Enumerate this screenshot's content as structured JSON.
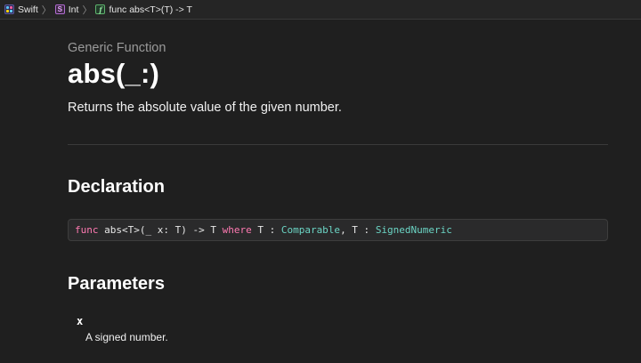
{
  "breadcrumb": [
    {
      "label": "Swift",
      "icon": "swift-module-icon"
    },
    {
      "label": "Int",
      "icon": "struct-icon",
      "badge": "S"
    },
    {
      "label": "func abs<T>(T) -> T",
      "icon": "function-icon",
      "badge": "f"
    }
  ],
  "header": {
    "eyebrow": "Generic Function",
    "title": "abs(_:)",
    "abstract": "Returns the absolute value of the given number."
  },
  "declaration": {
    "heading": "Declaration",
    "tokens": {
      "kw_func": "func",
      "sig": " abs<T>(_ x: T) -> T ",
      "kw_where": "where",
      "t1": " T : ",
      "type1": "Comparable",
      "t2": ", T : ",
      "type2": "SignedNumeric"
    }
  },
  "parameters": {
    "heading": "Parameters",
    "items": [
      {
        "name": "x",
        "description": "A signed number."
      }
    ]
  },
  "colors": {
    "background": "#1f1f1f",
    "keyword": "#ff7ab2",
    "type": "#6bd4c4"
  }
}
